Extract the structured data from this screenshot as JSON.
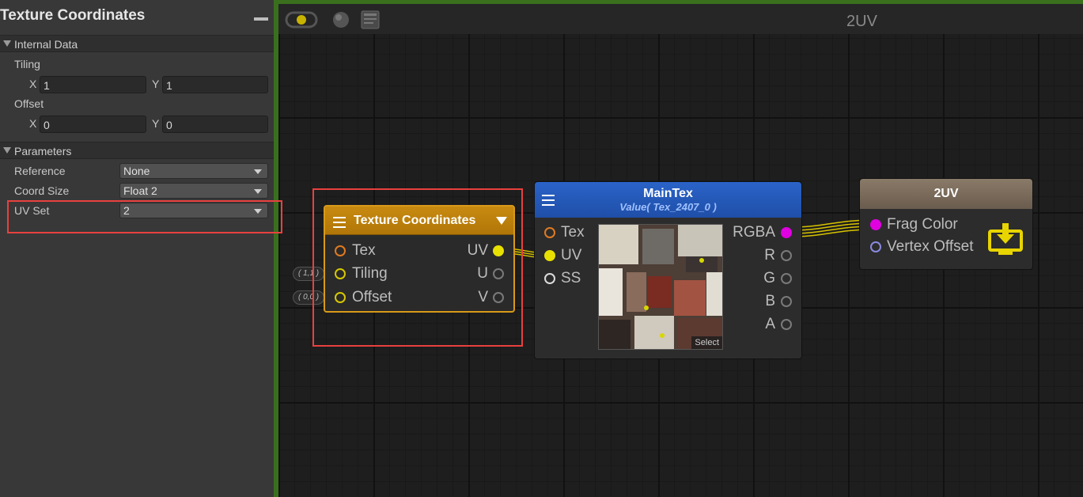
{
  "inspector": {
    "title": "Texture Coordinates",
    "internal_data": {
      "header": "Internal Data",
      "tiling_label": "Tiling",
      "tiling_x_label": "X",
      "tiling_x": "1",
      "tiling_y_label": "Y",
      "tiling_y": "1",
      "offset_label": "Offset",
      "offset_x_label": "X",
      "offset_x": "0",
      "offset_y_label": "Y",
      "offset_y": "0"
    },
    "parameters": {
      "header": "Parameters",
      "reference_label": "Reference",
      "reference_value": "None",
      "coord_size_label": "Coord Size",
      "coord_size_value": "Float 2",
      "uv_set_label": "UV Set",
      "uv_set_value": "2"
    }
  },
  "canvas": {
    "graph_name": "2UV",
    "accent_border": "#3a6f1e",
    "highlight_color": "#e8413e"
  },
  "nodes": {
    "texture_coordinates": {
      "title": "Texture Coordinates",
      "inputs": [
        "Tex",
        "Tiling",
        "Offset"
      ],
      "outputs": [
        "UV",
        "U",
        "V"
      ],
      "tiling_badge": "( 1,1 )",
      "offset_badge": "( 0,0 )",
      "header_color": "#c88a10"
    },
    "maintex": {
      "title": "MainTex",
      "subtitle": "Value( Tex_2407_0 )",
      "inputs": [
        "Tex",
        "UV",
        "SS"
      ],
      "outputs": [
        "RGBA",
        "R",
        "G",
        "B",
        "A"
      ],
      "select_label": "Select",
      "header_color": "#2a63c8"
    },
    "output": {
      "title": "2UV",
      "inputs": [
        "Frag Color",
        "Vertex Offset"
      ],
      "icon": "download-monitor-icon"
    }
  }
}
